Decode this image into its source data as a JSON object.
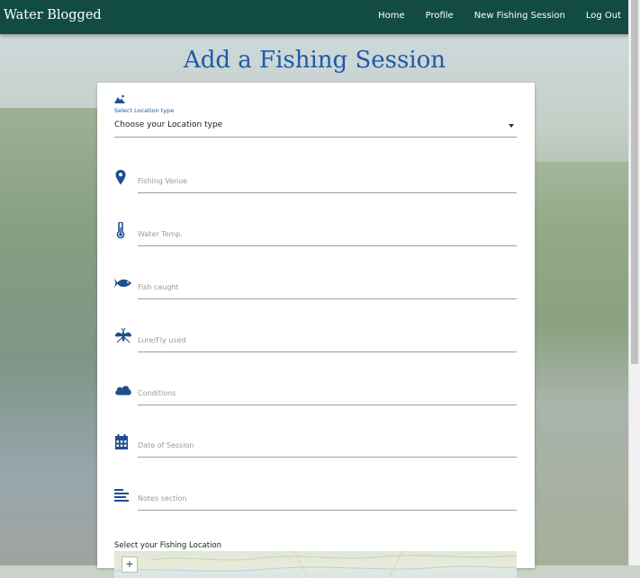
{
  "navbar": {
    "brand": "Water Blogged",
    "links": [
      "Home",
      "Profile",
      "New Fishing Session",
      "Log Out"
    ]
  },
  "page": {
    "title": "Add a Fishing Session"
  },
  "form": {
    "location_type": {
      "label": "Select Location type",
      "value": "Choose your Location type",
      "icon": "landscape-icon"
    },
    "fields": [
      {
        "placeholder": "Fishing Venue",
        "icon": "location-pin-icon"
      },
      {
        "placeholder": "Water Temp.",
        "icon": "thermometer-icon"
      },
      {
        "placeholder": "Fish caught",
        "icon": "fish-icon"
      },
      {
        "placeholder": "Lure/Fly used",
        "icon": "fly-icon"
      },
      {
        "placeholder": "Conditions",
        "icon": "cloud-icon"
      },
      {
        "placeholder": "Date of Session",
        "icon": "calendar-icon"
      },
      {
        "placeholder": "Notes section",
        "icon": "notes-icon"
      }
    ],
    "map_label": "Select your Fishing Location",
    "map_zoom_in": "+"
  },
  "colors": {
    "navbar": "#124b44",
    "accent": "#1e5aa8",
    "icon": "#1e4f8f"
  }
}
